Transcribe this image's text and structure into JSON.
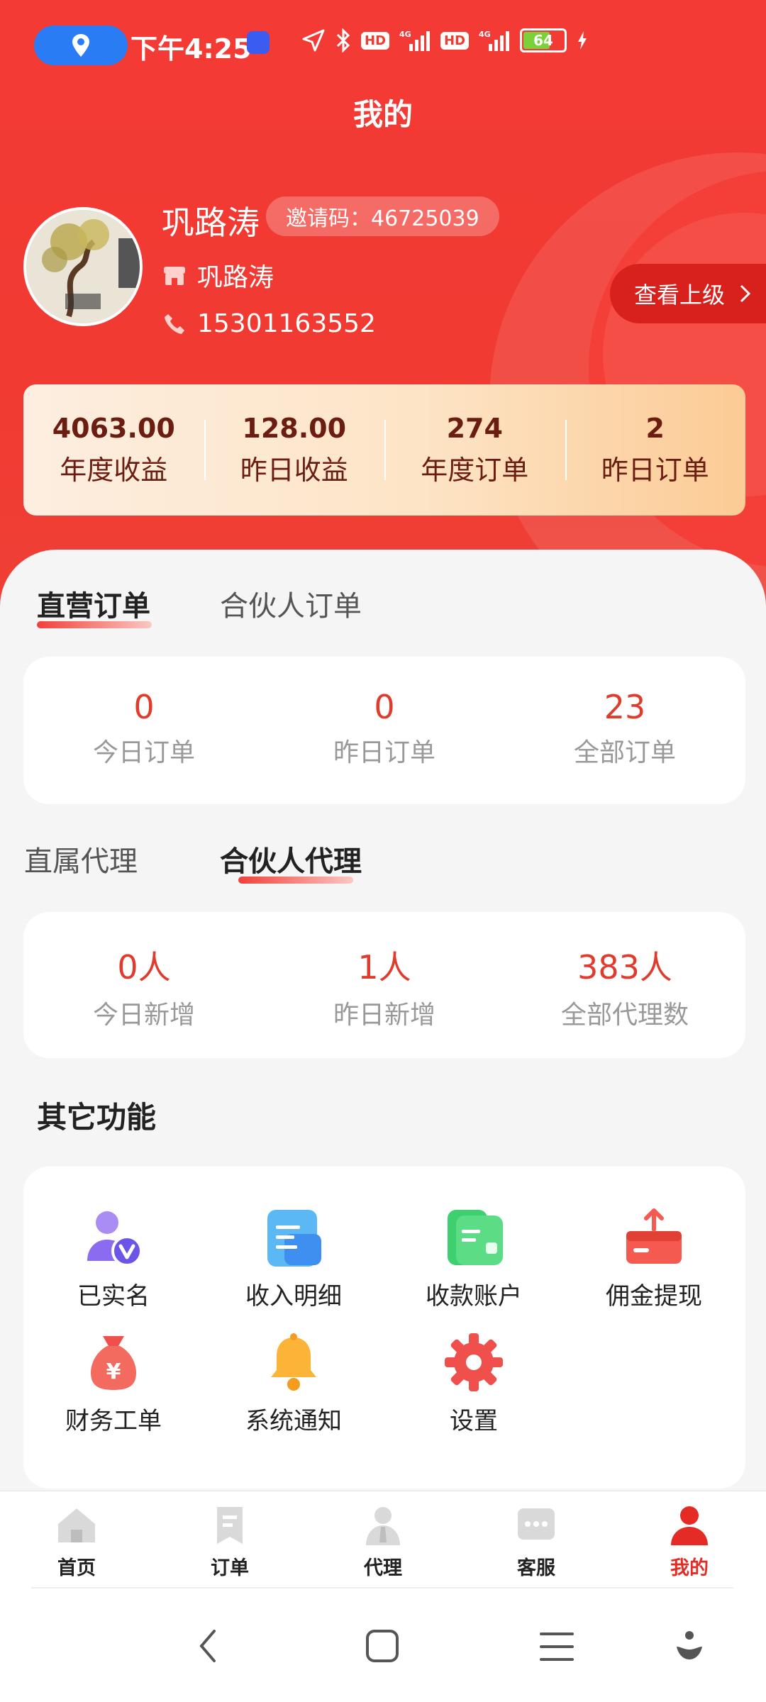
{
  "status_bar": {
    "time": "下午4:25",
    "battery": "64"
  },
  "page_title": "我的",
  "profile": {
    "name": "巩路涛",
    "invite_code": "邀请码：46725039",
    "shop_name": "巩路涛",
    "phone": "15301163552",
    "view_upper_label": "查看上级"
  },
  "stats": [
    {
      "value": "4063.00",
      "label": "年度收益"
    },
    {
      "value": "128.00",
      "label": "昨日收益"
    },
    {
      "value": "274",
      "label": "年度订单"
    },
    {
      "value": "2",
      "label": "昨日订单"
    }
  ],
  "order_tabs": [
    {
      "label": "直营订单"
    },
    {
      "label": "合伙人订单"
    }
  ],
  "order_metrics": [
    {
      "value": "0",
      "label": "今日订单"
    },
    {
      "value": "0",
      "label": "昨日订单"
    },
    {
      "value": "23",
      "label": "全部订单"
    }
  ],
  "agent_tabs": [
    {
      "label": "直属代理"
    },
    {
      "label": "合伙人代理"
    }
  ],
  "agent_metrics": [
    {
      "value": "0人",
      "label": "今日新增"
    },
    {
      "value": "1人",
      "label": "昨日新增"
    },
    {
      "value": "383人",
      "label": "全部代理数"
    }
  ],
  "other_functions": {
    "title": "其它功能",
    "items": [
      {
        "label": "已实名",
        "icon": "verified-user-icon"
      },
      {
        "label": "收入明细",
        "icon": "income-detail-icon"
      },
      {
        "label": "收款账户",
        "icon": "wallet-icon"
      },
      {
        "label": "佣金提现",
        "icon": "withdraw-icon"
      },
      {
        "label": "财务工单",
        "icon": "money-bag-icon"
      },
      {
        "label": "系统通知",
        "icon": "bell-icon"
      },
      {
        "label": "设置",
        "icon": "gear-icon"
      }
    ]
  },
  "bottom_nav": [
    {
      "label": "首页",
      "icon": "home-icon"
    },
    {
      "label": "订单",
      "icon": "order-icon"
    },
    {
      "label": "代理",
      "icon": "agent-icon"
    },
    {
      "label": "客服",
      "icon": "chat-icon"
    },
    {
      "label": "我的",
      "icon": "person-icon",
      "active": true
    }
  ],
  "colors": {
    "brand_red": "#f03a32",
    "accent_text": "#e03c2e"
  }
}
